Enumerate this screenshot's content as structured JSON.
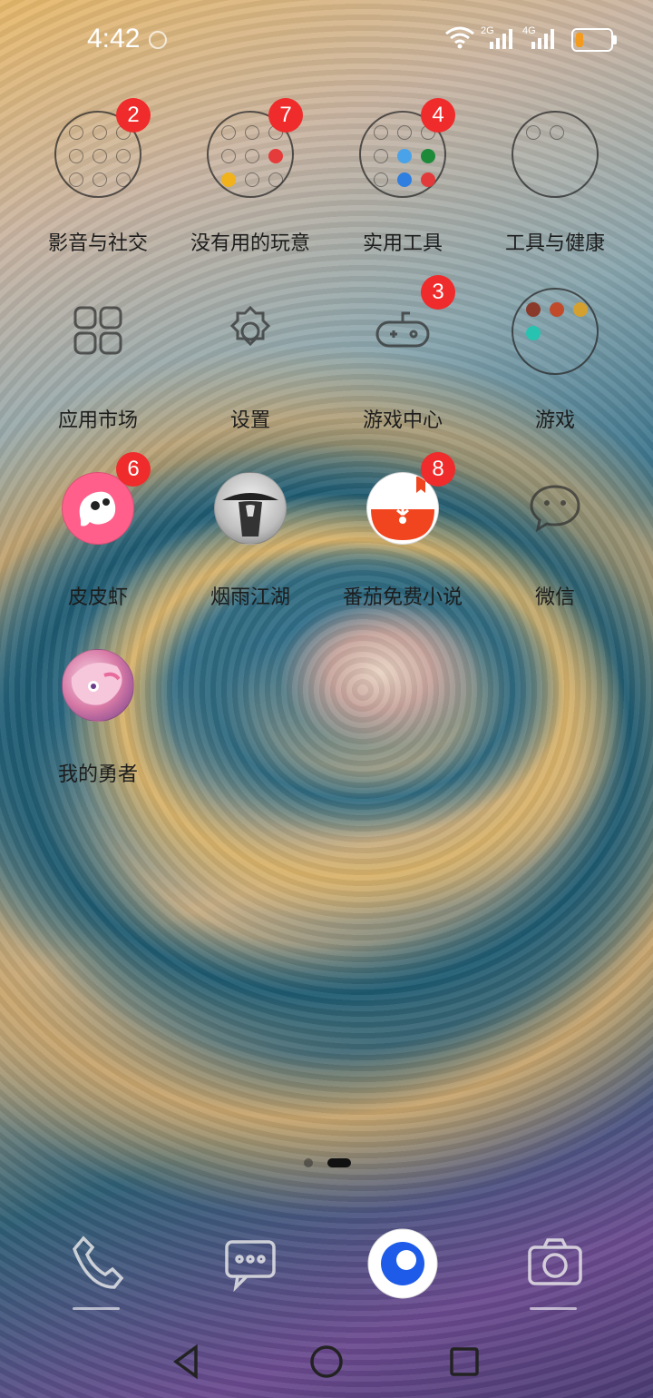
{
  "status_bar": {
    "time": "4:42",
    "sim1_network": "2G",
    "sim2_network": "4G",
    "battery_level_fraction": 0.15,
    "battery_color": "#f29b1e"
  },
  "home": {
    "rows": [
      [
        {
          "label": "影音与社交",
          "type": "folder",
          "badge": "2"
        },
        {
          "label": "没有用的玩意",
          "type": "folder",
          "badge": "7"
        },
        {
          "label": "实用工具",
          "type": "folder",
          "badge": "4"
        },
        {
          "label": "工具与健康",
          "type": "folder",
          "badge": ""
        }
      ],
      [
        {
          "label": "应用市场",
          "type": "app-market-icon",
          "badge": ""
        },
        {
          "label": "设置",
          "type": "gear-icon",
          "badge": ""
        },
        {
          "label": "游戏中心",
          "type": "gamepad-icon",
          "badge": "3"
        },
        {
          "label": "游戏",
          "type": "folder",
          "badge": ""
        }
      ],
      [
        {
          "label": "皮皮虾",
          "type": "pipixia-app-icon",
          "badge": "6"
        },
        {
          "label": "烟雨江湖",
          "type": "yanyujianghu-app-icon",
          "badge": ""
        },
        {
          "label": "番茄免费小说",
          "type": "fanqie-novel-app-icon",
          "badge": "8"
        },
        {
          "label": "微信",
          "type": "wechat-icon",
          "badge": ""
        }
      ],
      [
        {
          "label": "我的勇者",
          "type": "wodeyongzhe-app-icon",
          "badge": ""
        }
      ]
    ],
    "page_indicator": {
      "pages": 2,
      "active_page": 2
    }
  },
  "dock": [
    "phone-icon",
    "messages-icon",
    "browser-icon",
    "camera-icon"
  ],
  "nav_bar": [
    "back-button",
    "home-button",
    "recents-button"
  ]
}
